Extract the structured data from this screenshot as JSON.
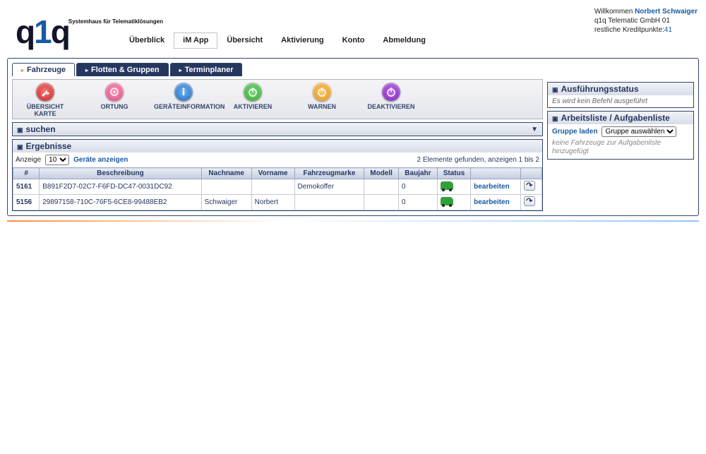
{
  "header": {
    "logo_tagline": "Systemhaus für Telematiklösungen",
    "welcome": "Willkommen",
    "username": "Norbert Schwaiger",
    "company": "q1q Telematic GmbH 01",
    "credits_label": "restliche Kreditpunkte:",
    "credits_value": "41"
  },
  "topnav": [
    "Überblick",
    "iM App",
    "Übersicht",
    "Aktivierung",
    "Konto",
    "Abmeldung"
  ],
  "topnav_selected": 1,
  "tabs": [
    "Fahrzeuge",
    "Flotten & Gruppen",
    "Terminplaner"
  ],
  "tabs_active": 0,
  "toolbar": [
    {
      "label": "ÜBERSICHT KARTE",
      "color": "o-red",
      "icon": "wrench"
    },
    {
      "label": "ORTUNG",
      "color": "o-pink",
      "icon": "target"
    },
    {
      "label": "GERÄTEINFORMATION",
      "color": "o-blue",
      "icon": "info"
    },
    {
      "label": "AKTIVIEREN",
      "color": "o-green",
      "icon": "power"
    },
    {
      "label": "WARNEN",
      "color": "o-orange",
      "icon": "power"
    },
    {
      "label": "DEAKTIVIEREN",
      "color": "o-dark",
      "icon": "power"
    }
  ],
  "search": {
    "title": "suchen"
  },
  "results": {
    "title": "Ergebnisse",
    "show_label": "Anzeige",
    "show_value": "10",
    "show_button": "Geräte anzeigen",
    "count_text": "2 Elemente gefunden, anzeigen 1 bis 2",
    "columns": [
      "#",
      "Beschreibung",
      "Nachname",
      "Vorname",
      "Fahrzeugmarke",
      "Modell",
      "Baujahr",
      "Status",
      "",
      ""
    ],
    "rows": [
      {
        "id": "5161",
        "desc": "B891F2D7-02C7-F6FD-DC47-0031DC92",
        "last": "",
        "first": "",
        "brand": "Demokoffer",
        "model": "",
        "year": "0",
        "edit": "bearbeiten"
      },
      {
        "id": "5156",
        "desc": "29897158-710C-76F5-6CE8-99488EB2",
        "last": "Schwaiger",
        "first": "Norbert",
        "brand": "",
        "model": "",
        "year": "0",
        "edit": "bearbeiten"
      }
    ]
  },
  "right": {
    "status_title": "Ausführungsstatus",
    "status_text": "Es wird kein Befehl ausgeführt",
    "worklist_title": "Arbeitsliste / Aufgabenliste",
    "group_label": "Gruppe laden",
    "group_select": "Gruppe auswählen",
    "worklist_note": "keine Fahrzeuge zur Aufgabenliste hinzugefügt"
  }
}
